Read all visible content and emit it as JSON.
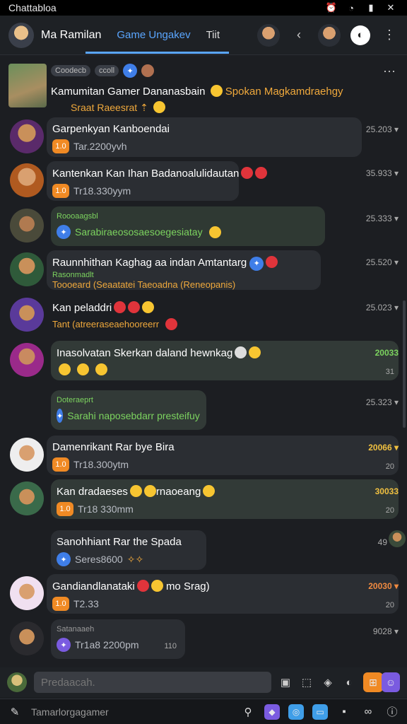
{
  "status": {
    "title": "Chattabloa"
  },
  "header": {
    "name": "Ma Ramilan",
    "tab_active": "Game Ungakev",
    "tab_other": "Tiit"
  },
  "pinned": {
    "tags": [
      "Coodecb",
      "ccoll"
    ],
    "title": "Kamumitan Gamer Dananasbain",
    "title_highlight": "Spokan Magkamdraehgy",
    "sub": "Sraat Raeesrat"
  },
  "rows": [
    {
      "title": "Garpenkyan Kanboendai",
      "sub": "Tar.2200yvh",
      "badge": "1.0",
      "time": "25.203"
    },
    {
      "title": "Kantenkan Kan Ihan Badanoalulidautan",
      "sub": "Tr18.330yym",
      "badge": "1.0",
      "time": "35.933"
    },
    {
      "title": "Sarabiraeososaesoegesiatay",
      "pre": "Roooaagsbl",
      "badge": "3",
      "time": "25.333"
    },
    {
      "title": "Raunnhithan Kaghag aa indan Amtantarg",
      "pre": "Rasonmadlt",
      "sub": "Toooeard (Seaatatei Taeoadna (Reneopanis)",
      "time": "25.520"
    },
    {
      "title": "Kan peladdri",
      "sub": "Tant (atreeraseaehooreerr",
      "time": "25.023"
    },
    {
      "title": "Inasolvatan Skerkan daland hewnkag",
      "time": "20033",
      "count": "31"
    },
    {
      "title": "Sarahi naposebdarr presteifuy",
      "pre": "Doteraeprt",
      "badge": "3",
      "time": "25.323"
    },
    {
      "title": "Damenrikant Rar bye Bira",
      "sub": "Tr18.300ytm",
      "badge": "1.0",
      "time": "20066",
      "count": "20"
    },
    {
      "title": "Kan dradaeses",
      "title_tail": "rnaoeang",
      "sub": "Tr18 330mm",
      "badge": "1.0",
      "time": "30033",
      "count": "20"
    },
    {
      "title": "Sanohhiant Rar the Spada",
      "sub": "Seres8600",
      "badge": "3",
      "time": "49"
    },
    {
      "title": "Gandiandlanataki",
      "title_tail": "mo Srag)",
      "sub": "T2.33",
      "badge": "1.0",
      "time": "20030",
      "count": "20"
    },
    {
      "pre": "Satanaaeh",
      "sub": "Tr1a8 2200pm",
      "badge": "3",
      "time": "9028",
      "count": "110"
    }
  ],
  "composer": {
    "placeholder": "Predaacah."
  },
  "bottom": {
    "text": "Tamarlorgagamer"
  },
  "colors": {
    "accent": "#5aa6ff",
    "orange": "#f08a24",
    "green": "#7cd35f",
    "bg": "#1c1e22"
  }
}
